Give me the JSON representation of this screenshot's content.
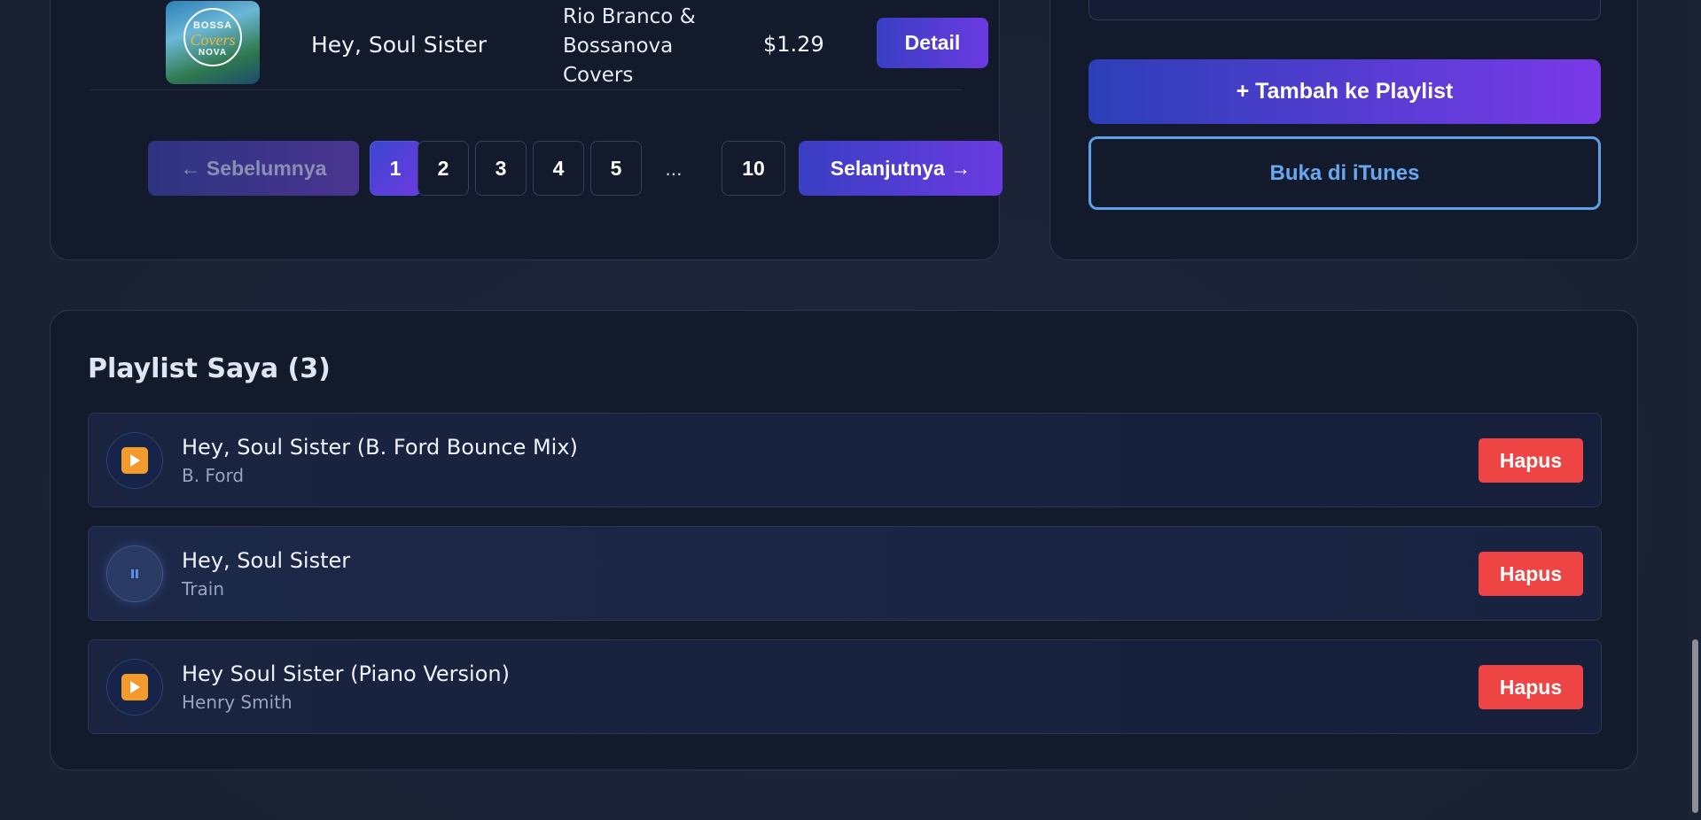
{
  "results": {
    "song": {
      "cover_text_top": "BOSSA",
      "cover_text_middle": "Covers",
      "cover_text_bottom": "NOVA",
      "title": "Hey, Soul Sister",
      "artist": "Rio Branco & Bossanova Covers",
      "price": "$1.29",
      "detail_label": "Detail"
    },
    "pager": {
      "prev_label": "← Sebelumnya",
      "pages": [
        "1",
        "2",
        "3",
        "4",
        "5"
      ],
      "dots": "...",
      "last_page": "10",
      "next_label": "Selanjutnya →",
      "active_page": "1"
    }
  },
  "player": {
    "add_label": "+ Tambah ke Playlist",
    "itunes_label": "Buka di iTunes"
  },
  "playlist": {
    "title": "Playlist Saya (3)",
    "delete_label": "Hapus",
    "items": [
      {
        "name": "Hey, Soul Sister (B. Ford Bounce Mix)",
        "artist": "B. Ford",
        "state": "play"
      },
      {
        "name": "Hey, Soul Sister",
        "artist": "Train",
        "state": "pause"
      },
      {
        "name": "Hey Soul Sister (Piano Version)",
        "artist": "Henry Smith",
        "state": "play"
      }
    ]
  },
  "colors": {
    "accent_gradient_start": "#3a3fc4",
    "accent_gradient_end": "#6a3ae0",
    "delete": "#ef4444",
    "link": "#69a8f0",
    "play_icon": "#f39a2a"
  }
}
